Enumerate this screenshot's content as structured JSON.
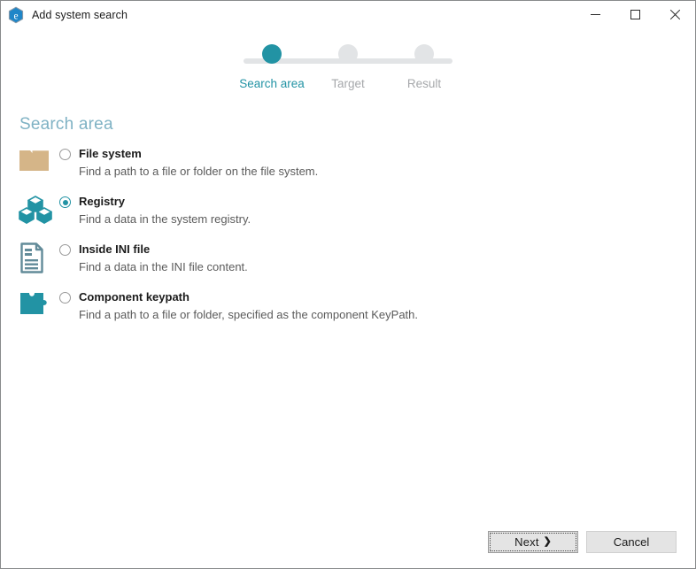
{
  "window": {
    "title": "Add system search",
    "icon": "app-hexagon-icon",
    "controls": {
      "minimize": "Minimize",
      "maximize": "Maximize",
      "close": "Close"
    }
  },
  "stepper": {
    "steps": [
      {
        "label": "Search area",
        "active": true
      },
      {
        "label": "Target",
        "active": false
      },
      {
        "label": "Result",
        "active": false
      }
    ]
  },
  "main": {
    "heading": "Search area",
    "options": [
      {
        "id": "file-system",
        "icon": "folder-icon",
        "title": "File system",
        "description": "Find a path to a file or folder on the file system.",
        "selected": false
      },
      {
        "id": "registry",
        "icon": "registry-cubes-icon",
        "title": "Registry",
        "description": "Find a data in the system registry.",
        "selected": true
      },
      {
        "id": "inside-ini-file",
        "icon": "ini-document-icon",
        "title": "Inside INI file",
        "description": "Find a data in the INI file content.",
        "selected": false
      },
      {
        "id": "component-keypath",
        "icon": "puzzle-piece-icon",
        "title": "Component keypath",
        "description": "Find a path to a file or folder, specified as the component KeyPath.",
        "selected": false
      }
    ]
  },
  "footer": {
    "next_label": "Next",
    "next_chevron": "❯",
    "cancel_label": "Cancel"
  },
  "colors": {
    "accent_teal": "#2293a4",
    "heading_blue": "#7fb2c4",
    "inactive_gray": "#e2e4e6",
    "folder_tan": "#d5b588",
    "doc_slate": "#628b99"
  }
}
